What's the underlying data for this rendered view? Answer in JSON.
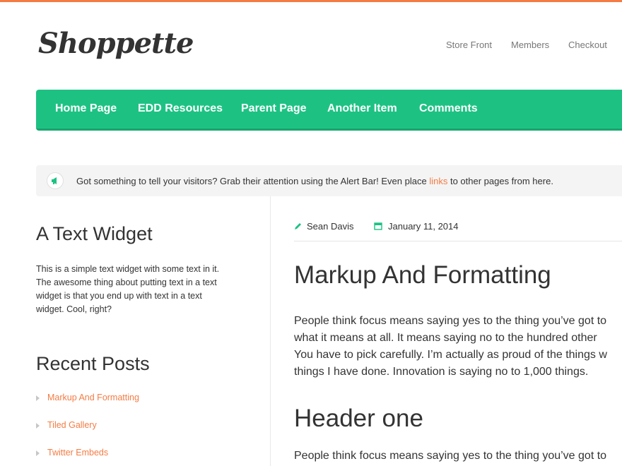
{
  "site": {
    "logo": "Shoppette",
    "accent": "#f47c44",
    "nav_color": "#1dc283"
  },
  "top_nav": [
    "Store Front",
    "Members",
    "Checkout"
  ],
  "main_nav": [
    "Home Page",
    "EDD Resources",
    "Parent Page",
    "Another Item",
    "Comments"
  ],
  "alert_bar": {
    "icon": "megaphone-icon",
    "text_before": "Got something to tell your visitors? Grab their attention using the Alert Bar! Even place ",
    "link_text": "links",
    "text_after": " to other pages from here."
  },
  "sidebar": {
    "text_widget": {
      "title": "A Text Widget",
      "lines": [
        "This is a simple text widget with some text in it.",
        "The awesome thing about putting text in a text",
        "widget is that you end up with text in a text",
        "widget. Cool, right?"
      ]
    },
    "recent_posts": {
      "title": "Recent Posts",
      "items": [
        "Markup And Formatting",
        "Tiled Gallery",
        "Twitter Embeds"
      ]
    }
  },
  "post": {
    "author_icon": "pencil-icon",
    "author": "Sean Davis",
    "date_icon": "calendar-icon",
    "date": "January 11, 2014",
    "title": "Markup And Formatting",
    "paragraph1": [
      "People think focus means saying yes to the thing you’ve got to",
      "what it means at all. It means saying no to the hundred other",
      "You have to pick carefully. I’m actually as proud of the things w",
      "things I have done. Innovation is saying no to 1,000 things."
    ],
    "header_one": "Header one",
    "paragraph2": [
      "People think focus means saying yes to the thing you’ve got to"
    ]
  }
}
